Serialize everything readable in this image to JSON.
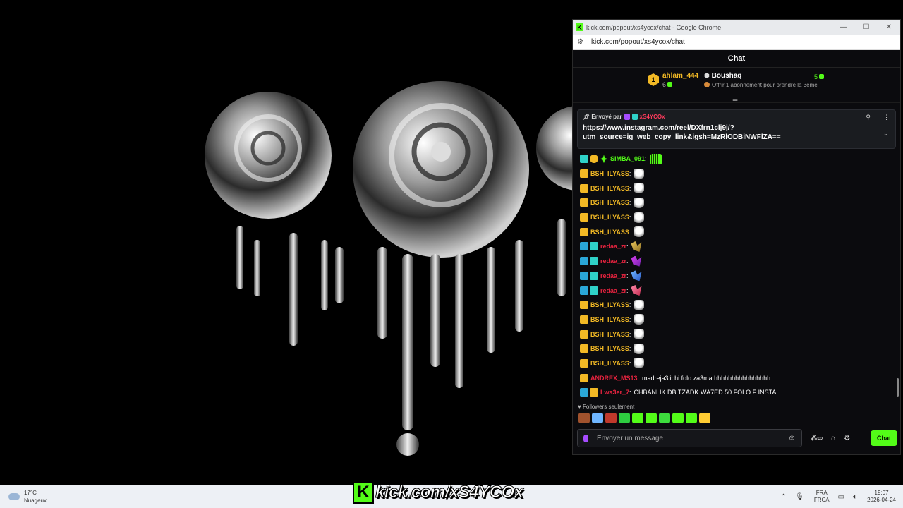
{
  "window": {
    "title": "kick.com/popout/xs4ycox/chat - Google Chrome",
    "url": "kick.com/popout/xs4ycox/chat",
    "favicon": "K"
  },
  "chat": {
    "header": "Chat",
    "leaderboard": {
      "first": {
        "rank": "1",
        "name": "ahlam_444",
        "count": "6"
      },
      "second": {
        "name": "Boushaq",
        "count": "5",
        "hint": "Offrir 1 abonnement pour prendre la 3ème"
      }
    },
    "pinned": {
      "sent_by_label": "Envoyé par",
      "sender": "xS4YCOx",
      "link_line1": "https://www.instagram.com/reel/DXfrn1clj9j/?",
      "link_line2": "utm_source=ig_web_copy_link&igsh=MzRlODBiNWFlZA=="
    },
    "messages": [
      {
        "user": "SIMBA_091",
        "color": "#53fc18",
        "badges": [
          "cyan",
          "gold",
          "green"
        ],
        "emote": "em-bars",
        "text": ""
      },
      {
        "user": "BSH_ILYASS",
        "color": "#f2b925",
        "badges": [
          "crown"
        ],
        "emote": "em-white",
        "text": ""
      },
      {
        "user": "BSH_ILYASS",
        "color": "#f2b925",
        "badges": [
          "crown"
        ],
        "emote": "em-white",
        "text": ""
      },
      {
        "user": "BSH_ILYASS",
        "color": "#f2b925",
        "badges": [
          "crown"
        ],
        "emote": "em-white",
        "text": ""
      },
      {
        "user": "BSH_ILYASS",
        "color": "#f2b925",
        "badges": [
          "crown"
        ],
        "emote": "em-white",
        "text": ""
      },
      {
        "user": "BSH_ILYASS",
        "color": "#f2b925",
        "badges": [
          "crown"
        ],
        "emote": "em-white",
        "text": ""
      },
      {
        "user": "redaa_zr",
        "color": "#e8233f",
        "badges": [
          "blue",
          "cyan"
        ],
        "emote": "em-gold",
        "text": ""
      },
      {
        "user": "redaa_zr",
        "color": "#e8233f",
        "badges": [
          "blue",
          "cyan"
        ],
        "emote": "em-purple",
        "text": ""
      },
      {
        "user": "redaa_zr",
        "color": "#e8233f",
        "badges": [
          "blue",
          "cyan"
        ],
        "emote": "em-blue",
        "text": ""
      },
      {
        "user": "redaa_zr",
        "color": "#e8233f",
        "badges": [
          "blue",
          "cyan"
        ],
        "emote": "em-pink",
        "text": ""
      },
      {
        "user": "BSH_ILYASS",
        "color": "#f2b925",
        "badges": [
          "crown"
        ],
        "emote": "em-white",
        "text": ""
      },
      {
        "user": "BSH_ILYASS",
        "color": "#f2b925",
        "badges": [
          "crown"
        ],
        "emote": "em-white",
        "text": ""
      },
      {
        "user": "BSH_ILYASS",
        "color": "#f2b925",
        "badges": [
          "crown"
        ],
        "emote": "em-white",
        "text": ""
      },
      {
        "user": "BSH_ILYASS",
        "color": "#f2b925",
        "badges": [
          "crown"
        ],
        "emote": "em-white",
        "text": ""
      },
      {
        "user": "BSH_ILYASS",
        "color": "#f2b925",
        "badges": [
          "crown"
        ],
        "emote": "em-white",
        "text": ""
      },
      {
        "user": "ANDREX_MS13",
        "color": "#e8233f",
        "badges": [
          "crown"
        ],
        "emote": "",
        "text": "madreja3lichi folo za3ma hhhhhhhhhhhhhhhh"
      },
      {
        "user": "Lwa3er_7",
        "color": "#e8233f",
        "badges": [
          "blue",
          "crown"
        ],
        "emote": "",
        "text": "CHBANLIK DB TZADK WA7ED 50 FOLO F INSTA"
      }
    ],
    "followers_only": "Followers seulement",
    "quick_emotes": [
      "#a0522d",
      "#6fb6ff",
      "#c0392b",
      "#2ecc40",
      "#53fc18",
      "#53fc18",
      "#3ddc3d",
      "#53fc18",
      "#53fc18",
      "#ffcc33"
    ],
    "input": {
      "placeholder": "Envoyer un message"
    },
    "send_label": "Chat"
  },
  "taskbar": {
    "weather_temp": "17°C",
    "weather_desc": "Nuageux",
    "brand_text": "kick.com/xS4YCOx",
    "lang_top": "FRA",
    "lang_bottom": "FRCA",
    "time": "19:07",
    "date": "2026-04-24"
  }
}
